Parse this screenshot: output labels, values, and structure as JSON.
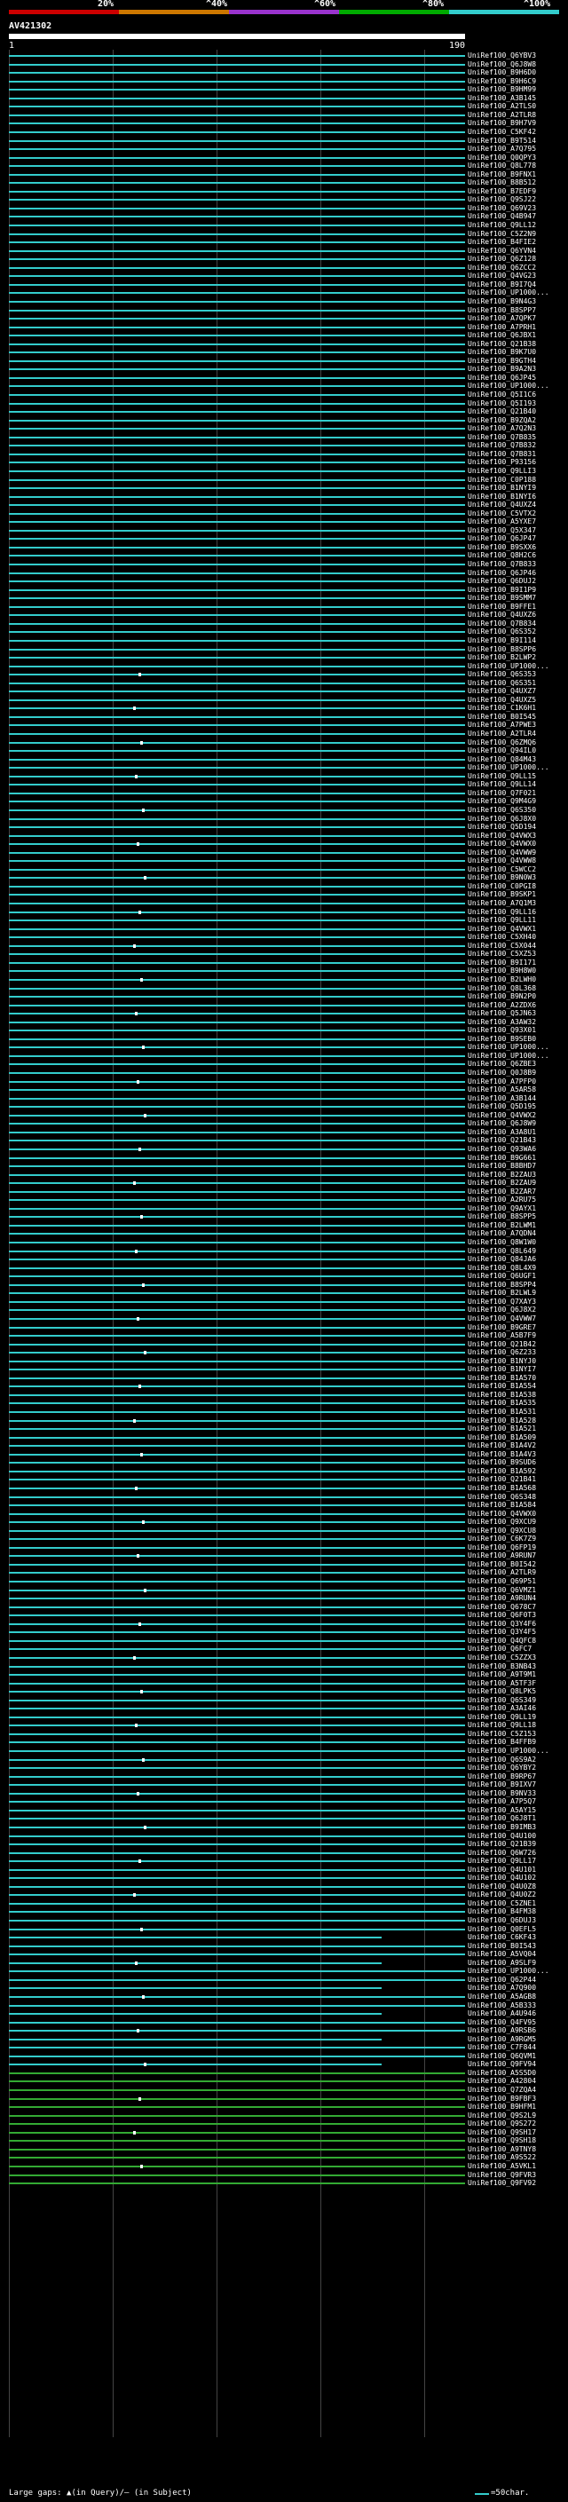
{
  "scale": {
    "labels": [
      "20%",
      "^40%",
      "^60%",
      "^80%",
      "^100%"
    ],
    "colors": [
      "#cc0000",
      "#cc7700",
      "#9933cc",
      "#00aa00",
      "#33cccc"
    ]
  },
  "query": {
    "title": "AV421302",
    "start": "1",
    "end": "190"
  },
  "hits": [
    "UniRef100_Q6YBV3",
    "UniRef100_Q6J8W8",
    "UniRef100_B9H6D0",
    "UniRef100_B9H6C9",
    "UniRef100_B9HM99",
    "UniRef100_A3B145",
    "UniRef100_A2TLS0",
    "UniRef100_A2TLR8",
    "UniRef100_B9H7V9",
    "UniRef100_C5KF42",
    "UniRef100_B9T514",
    "UniRef100_A7Q795",
    "UniRef100_Q0QPY3",
    "UniRef100_Q8L778",
    "UniRef100_B9FNX1",
    "UniRef100_B8B512",
    "UniRef100_B7EDF9",
    "UniRef100_Q9SJ22",
    "UniRef100_Q69V23",
    "UniRef100_Q4B947",
    "UniRef100_Q9LL12",
    "UniRef100_C5Z2N9",
    "UniRef100_B4FIE2",
    "UniRef100_Q6YVN4",
    "UniRef100_Q6Z128",
    "UniRef100_Q6ZCC2",
    "UniRef100_Q4VG23",
    "UniRef100_B9I7Q4",
    "UniRef100_UP1000...",
    "UniRef100_B9N4G3",
    "UniRef100_B8SPP7",
    "UniRef100_A7QPK7",
    "UniRef100_A7PRH1",
    "UniRef100_Q6JBX1",
    "UniRef100_Q21B38",
    "UniRef100_B9K7U0",
    "UniRef100_B9GTH4",
    "UniRef100_B9A2N3",
    "UniRef100_Q6JP45",
    "UniRef100_UP1000...",
    "UniRef100_Q5I1C6",
    "UniRef100_Q5I193",
    "UniRef100_Q21B40",
    "UniRef100_B9ZQA2",
    "UniRef100_A7Q2N3",
    "UniRef100_Q7B835",
    "UniRef100_Q7B832",
    "UniRef100_Q7B831",
    "UniRef100_P93156",
    "UniRef100_Q9LLI3",
    "UniRef100_C0P188",
    "UniRef100_B1NYI9",
    "UniRef100_B1NYI6",
    "UniRef100_Q4UXZ4",
    "UniRef100_C5VTX2",
    "UniRef100_A5YXE7",
    "UniRef100_Q5X347",
    "UniRef100_Q6JP47",
    "UniRef100_B9SXX6",
    "UniRef100_Q8H2C6",
    "UniRef100_Q7B833",
    "UniRef100_Q6JP46",
    "UniRef100_Q6DUJ2",
    "UniRef100_B9I1P9",
    "UniRef100_B9SMM7",
    "UniRef100_B9FFE1",
    "UniRef100_Q4UXZ6",
    "UniRef100_Q7B834",
    "UniRef100_Q6S352",
    "UniRef100_B9I114",
    "UniRef100_B8SPP6",
    "UniRef100_B2LWP2",
    "UniRef100_UP1000...",
    "UniRef100_Q6S353",
    "UniRef100_Q6S351",
    "UniRef100_Q4UXZ7",
    "UniRef100_Q4UXZ5",
    "UniRef100_C1K6H1",
    "UniRef100_B0I545",
    "UniRef100_A7PWE3",
    "UniRef100_A2TLR4",
    "UniRef100_Q6ZMQ6",
    "UniRef100_Q94IL0",
    "UniRef100_Q84M43",
    "UniRef100_UP1000...",
    "UniRef100_Q9LL15",
    "UniRef100_Q9LL14",
    "UniRef100_Q7F021",
    "UniRef100_Q9M4G9",
    "UniRef100_Q6S350",
    "UniRef100_Q6J8X0",
    "UniRef100_Q5D194",
    "UniRef100_Q4VWX3",
    "UniRef100_Q4VWX0",
    "UniRef100_Q4VWW9",
    "UniRef100_Q4VWW8",
    "UniRef100_C5WCC2",
    "UniRef100_B9N0W3",
    "UniRef100_C0PGI8",
    "UniRef100_B9SKP1",
    "UniRef100_A7Q1M3",
    "UniRef100_Q9LL16",
    "UniRef100_Q9LL11",
    "UniRef100_Q4VWX1",
    "UniRef100_C5XH40",
    "UniRef100_C5X044",
    "UniRef100_C5XZ53",
    "UniRef100_B9I171",
    "UniRef100_B9H8W0",
    "UniRef100_B2LWH0",
    "UniRef100_Q8L368",
    "UniRef100_B9N2P0",
    "UniRef100_A2ZDX6",
    "UniRef100_Q5JN63",
    "UniRef100_A3AW32",
    "UniRef100_Q93X01",
    "UniRef100_B9SEB0",
    "UniRef100_UP1000...",
    "UniRef100_UP1000...",
    "UniRef100_Q6ZBE3",
    "UniRef100_Q0J8B9",
    "UniRef100_A7PFP0",
    "UniRef100_A5AR58",
    "UniRef100_A3B144",
    "UniRef100_Q5D195",
    "UniRef100_Q4VWX2",
    "UniRef100_Q6J8W9",
    "UniRef100_A3A8U1",
    "UniRef100_Q21B43",
    "UniRef100_Q93WA6",
    "UniRef100_B9G661",
    "UniRef100_B8BHD7",
    "UniRef100_B2ZAU3",
    "UniRef100_B2ZAU9",
    "UniRef100_B2ZAR7",
    "UniRef100_A2RU75",
    "UniRef100_Q9AYX1",
    "UniRef100_B8SPP5",
    "UniRef100_B2LWM1",
    "UniRef100_A7QDN4",
    "UniRef100_Q8W1W0",
    "UniRef100_Q8L649",
    "UniRef100_Q84JA6",
    "UniRef100_Q8L4X9",
    "UniRef100_Q6UGF1",
    "UniRef100_B8SPP4",
    "UniRef100_B2LWL9",
    "UniRef100_Q7XAY3",
    "UniRef100_Q6J8X2",
    "UniRef100_Q4VWW7",
    "UniRef100_B9GRE7",
    "UniRef100_A5B7F9",
    "UniRef100_Q21B42",
    "UniRef100_Q6Z233",
    "UniRef100_B1NYJ0",
    "UniRef100_B1NYI7",
    "UniRef100_B1A570",
    "UniRef100_B1A554",
    "UniRef100_B1A538",
    "UniRef100_B1A535",
    "UniRef100_B1A531",
    "UniRef100_B1A528",
    "UniRef100_B1A521",
    "UniRef100_B1A509",
    "UniRef100_B1A4V2",
    "UniRef100_B1A4V3",
    "UniRef100_B9SUD6",
    "UniRef100_B1A592",
    "UniRef100_Q21B41",
    "UniRef100_B1A568",
    "UniRef100_Q6S348",
    "UniRef100_B1A584",
    "UniRef100_Q4VWX0",
    "UniRef100_Q9XCU9",
    "UniRef100_Q9XCU8",
    "UniRef100_C6K7Z9",
    "UniRef100_Q6FP19",
    "UniRef100_A9RUN7",
    "UniRef100_B0I542",
    "UniRef100_A2TLR9",
    "UniRef100_Q69P51",
    "UniRef100_Q6VMZ1",
    "UniRef100_A9RUN4",
    "UniRef100_Q678C7",
    "UniRef100_Q6F0T3",
    "UniRef100_Q3Y4F6",
    "UniRef100_Q3Y4F5",
    "UniRef100_Q4QFC8",
    "UniRef100_Q6FC7",
    "UniRef100_C5ZZX3",
    "UniRef100_B3NB43",
    "UniRef100_A9T9M1",
    "UniRef100_A5TF3F",
    "UniRef100_Q8LPK5",
    "UniRef100_Q6S349",
    "UniRef100_A3AI46",
    "UniRef100_Q9LL19",
    "UniRef100_Q9LL18",
    "UniRef100_C5Z153",
    "UniRef100_B4FFB9",
    "UniRef100_UP1000...",
    "UniRef100_Q6S9A2",
    "UniRef100_Q6YBY2",
    "UniRef100_B9RP67",
    "UniRef100_B9IXV7",
    "UniRef100_B9NV33",
    "UniRef100_A7P5Q7",
    "UniRef100_A5AY15",
    "UniRef100_Q6J8T1",
    "UniRef100_B9IMB3",
    "UniRef100_Q4U100",
    "UniRef100_Q21B39",
    "UniRef100_Q6W726",
    "UniRef100_Q9LL17",
    "UniRef100_Q4U101",
    "UniRef100_Q4U102",
    "UniRef100_Q4U0Z8",
    "UniRef100_Q4U0Z2",
    "UniRef100_C5ZNE1",
    "UniRef100_B4FM38",
    "UniRef100_Q6DUJ3",
    "UniRef100_Q0EFL5",
    "UniRef100_C6KF43",
    "UniRef100_B0I543",
    "UniRef100_A5VQ04",
    "UniRef100_A9SLF9",
    "UniRef100_UP1000...",
    "UniRef100_Q62P44",
    "UniRef100_A7Q900",
    "UniRef100_A5AGB8",
    "UniRef100_A5B333",
    "UniRef100_A4U946",
    "UniRef100_Q4FV95",
    "UniRef100_A9RSB6",
    "UniRef100_A9RGM5",
    "UniRef100_C7F844",
    "UniRef100_Q6QVM1",
    "UniRef100_Q9FV94",
    "UniRef100_A5S5D0",
    "UniRef100_A42804",
    "UniRef100_Q7ZQA4",
    "UniRef100_B9FBF3",
    "UniRef100_B9HFM1",
    "UniRef100_Q9S2L9",
    "UniRef100_Q9S272",
    "UniRef100_Q9SH17",
    "UniRef100_Q9SH18",
    "UniRef100_A9TNY8",
    "UniRef100_A9S522",
    "UniRef100_A5VKL1",
    "UniRef100_Q9FVR3",
    "UniRef100_Q9FV92"
  ],
  "legend": {
    "gaps_text": "Large gaps: ▲(in Query)/— (in Subject)",
    "scale_text": "=50char."
  }
}
